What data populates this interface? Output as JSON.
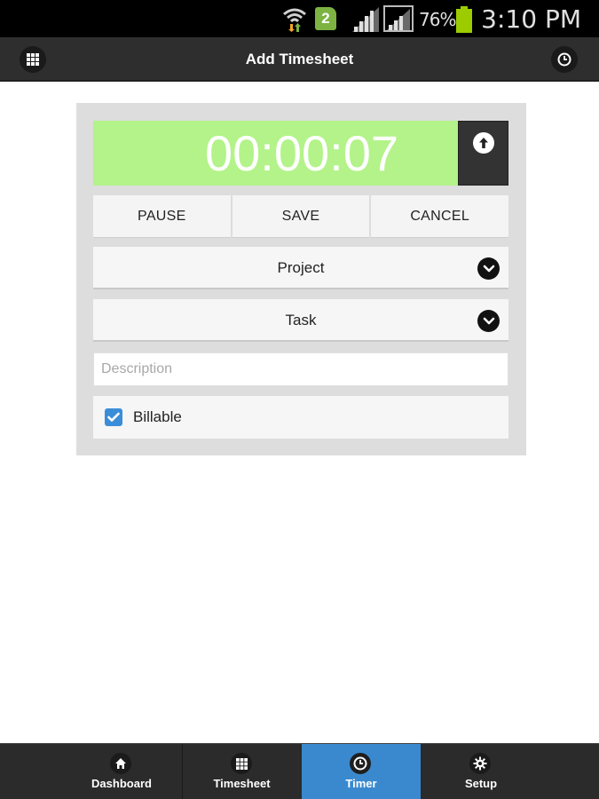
{
  "status_bar": {
    "sim_label": "2",
    "battery_percent": "76%",
    "time": "3:10 PM",
    "battery_color": "#9ccc00"
  },
  "header": {
    "title": "Add Timesheet",
    "left_icon": "grid-menu-icon",
    "right_icon": "clock-icon"
  },
  "timer": {
    "elapsed": "00:00:07",
    "display_color": "#b3f38a",
    "collapse_icon": "arrow-up-icon"
  },
  "actions": {
    "pause_label": "PAUSE",
    "save_label": "SAVE",
    "cancel_label": "CANCEL"
  },
  "form": {
    "project_label": "Project",
    "task_label": "Task",
    "description_placeholder": "Description",
    "description_value": "",
    "billable_label": "Billable",
    "billable_checked": true
  },
  "bottom_nav": {
    "active_color": "#3a89cf",
    "items": [
      {
        "label": "Dashboard",
        "icon": "home-icon",
        "active": false
      },
      {
        "label": "Timesheet",
        "icon": "grid-icon",
        "active": false
      },
      {
        "label": "Timer",
        "icon": "clock-icon",
        "active": true
      },
      {
        "label": "Setup",
        "icon": "gear-icon",
        "active": false
      }
    ]
  }
}
